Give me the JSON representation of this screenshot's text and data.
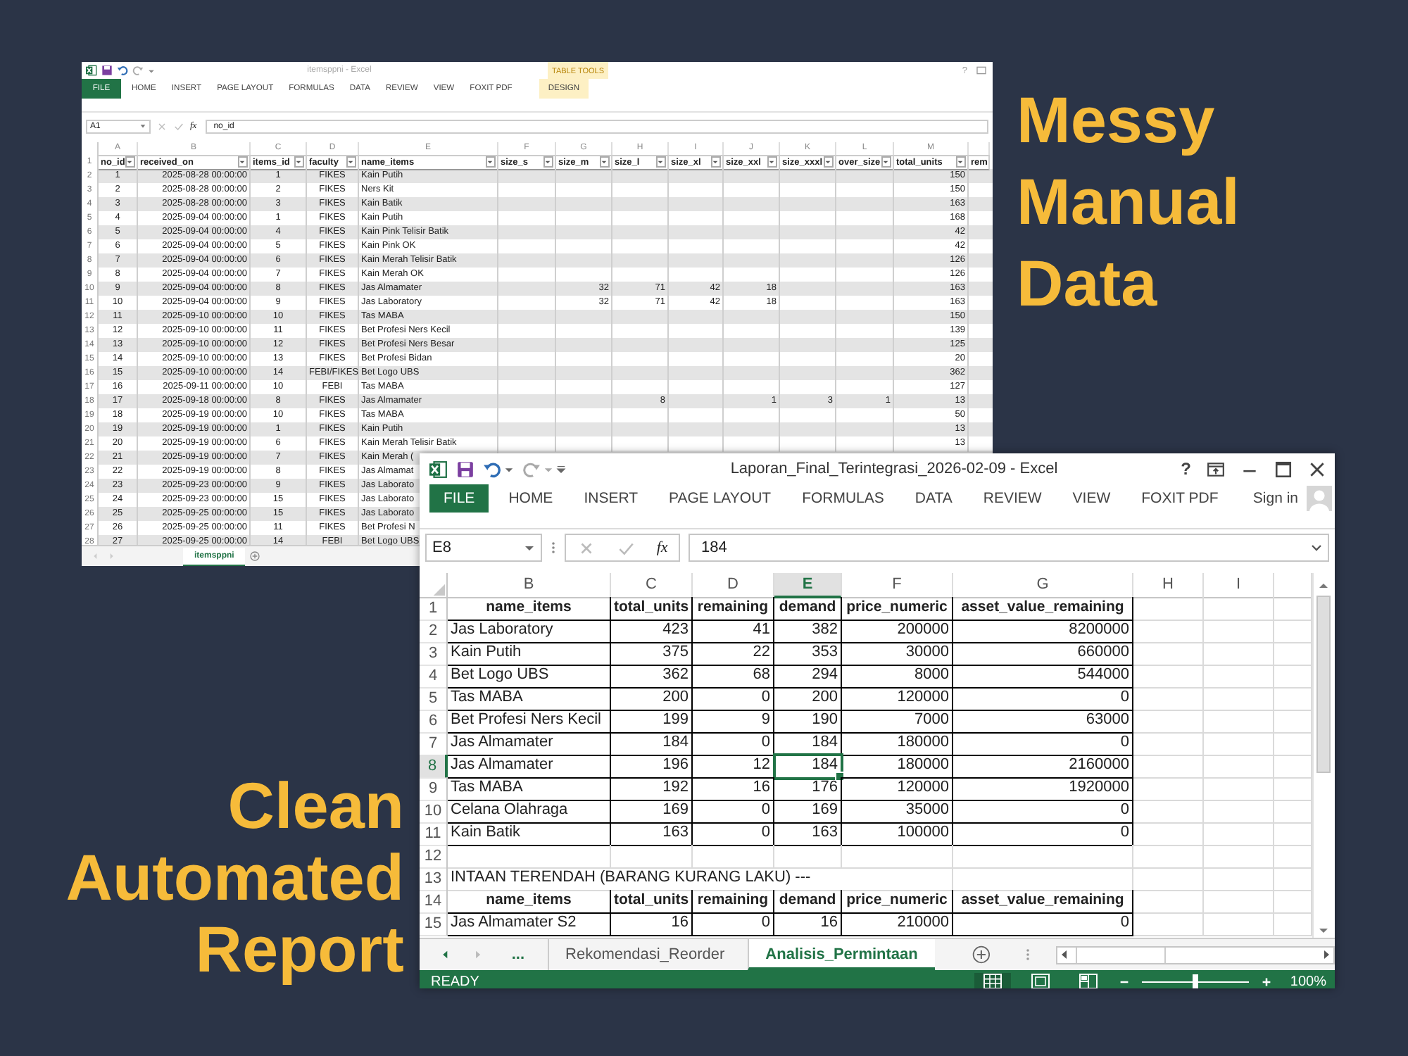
{
  "headline_top": [
    "Messy",
    "Manual",
    "Data"
  ],
  "headline_bottom": [
    "Clean",
    "Automated",
    "Report"
  ],
  "back_window": {
    "title": "itemsppni - Excel",
    "contextual_tab_group": "TABLE TOOLS",
    "help_label": "?",
    "ribbon_tabs": [
      {
        "label": "FILE",
        "kind": "file"
      },
      {
        "label": "HOME",
        "kind": "tab"
      },
      {
        "label": "INSERT",
        "kind": "tab"
      },
      {
        "label": "PAGE LAYOUT",
        "kind": "tab"
      },
      {
        "label": "FORMULAS",
        "kind": "tab"
      },
      {
        "label": "DATA",
        "kind": "tab"
      },
      {
        "label": "REVIEW",
        "kind": "tab"
      },
      {
        "label": "VIEW",
        "kind": "tab"
      },
      {
        "label": "FOXIT PDF",
        "kind": "tab"
      },
      {
        "label": "DESIGN",
        "kind": "contextual"
      }
    ],
    "name_box": "A1",
    "function_label": "fx",
    "formula": "no_id",
    "header_row_number": "1",
    "column_letters": [
      "A",
      "B",
      "C",
      "D",
      "E",
      "F",
      "G",
      "H",
      "I",
      "J",
      "K",
      "L",
      "M"
    ],
    "headers": [
      "no_id",
      "received_on",
      "items_id",
      "faculty",
      "name_items",
      "size_s",
      "size_m",
      "size_l",
      "size_xl",
      "size_xxl",
      "size_xxxl",
      "over_size",
      "total_units",
      "rem"
    ],
    "rows": [
      {
        "n": "2",
        "cells": [
          "1",
          "2025-08-28 00:00:00",
          "1",
          "FIKES",
          "Kain Putih",
          null,
          null,
          null,
          null,
          null,
          null,
          null,
          "150"
        ]
      },
      {
        "n": "3",
        "cells": [
          "2",
          "2025-08-28 00:00:00",
          "2",
          "FIKES",
          "Ners Kit",
          null,
          null,
          null,
          null,
          null,
          null,
          null,
          "150"
        ]
      },
      {
        "n": "4",
        "cells": [
          "3",
          "2025-08-28 00:00:00",
          "3",
          "FIKES",
          "Kain Batik",
          null,
          null,
          null,
          null,
          null,
          null,
          null,
          "163"
        ]
      },
      {
        "n": "5",
        "cells": [
          "4",
          "2025-09-04 00:00:00",
          "1",
          "FIKES",
          "Kain Putih",
          null,
          null,
          null,
          null,
          null,
          null,
          null,
          "168"
        ]
      },
      {
        "n": "6",
        "cells": [
          "5",
          "2025-09-04 00:00:00",
          "4",
          "FIKES",
          "Kain Pink Telisir Batik",
          null,
          null,
          null,
          null,
          null,
          null,
          null,
          "42"
        ]
      },
      {
        "n": "7",
        "cells": [
          "6",
          "2025-09-04 00:00:00",
          "5",
          "FIKES",
          "Kain Pink OK",
          null,
          null,
          null,
          null,
          null,
          null,
          null,
          "42"
        ]
      },
      {
        "n": "8",
        "cells": [
          "7",
          "2025-09-04 00:00:00",
          "6",
          "FIKES",
          "Kain Merah Telisir Batik",
          null,
          null,
          null,
          null,
          null,
          null,
          null,
          "126"
        ]
      },
      {
        "n": "9",
        "cells": [
          "8",
          "2025-09-04 00:00:00",
          "7",
          "FIKES",
          "Kain Merah OK",
          null,
          null,
          null,
          null,
          null,
          null,
          null,
          "126"
        ]
      },
      {
        "n": "10",
        "cells": [
          "9",
          "2025-09-04 00:00:00",
          "8",
          "FIKES",
          "Jas Almamater",
          null,
          "32",
          "71",
          "42",
          "18",
          null,
          null,
          "163"
        ]
      },
      {
        "n": "11",
        "cells": [
          "10",
          "2025-09-04 00:00:00",
          "9",
          "FIKES",
          "Jas Laboratory",
          null,
          "32",
          "71",
          "42",
          "18",
          null,
          null,
          "163"
        ]
      },
      {
        "n": "12",
        "cells": [
          "11",
          "2025-09-10 00:00:00",
          "10",
          "FIKES",
          "Tas MABA",
          null,
          null,
          null,
          null,
          null,
          null,
          null,
          "150"
        ]
      },
      {
        "n": "13",
        "cells": [
          "12",
          "2025-09-10 00:00:00",
          "11",
          "FIKES",
          "Bet Profesi Ners Kecil",
          null,
          null,
          null,
          null,
          null,
          null,
          null,
          "139"
        ]
      },
      {
        "n": "14",
        "cells": [
          "13",
          "2025-09-10 00:00:00",
          "12",
          "FIKES",
          "Bet Profesi Ners Besar",
          null,
          null,
          null,
          null,
          null,
          null,
          null,
          "125"
        ]
      },
      {
        "n": "15",
        "cells": [
          "14",
          "2025-09-10 00:00:00",
          "13",
          "FIKES",
          "Bet Profesi Bidan",
          null,
          null,
          null,
          null,
          null,
          null,
          null,
          "20"
        ]
      },
      {
        "n": "16",
        "cells": [
          "15",
          "2025-09-10 00:00:00",
          "14",
          "FEBI/FIKES",
          "Bet Logo UBS",
          null,
          null,
          null,
          null,
          null,
          null,
          null,
          "362"
        ]
      },
      {
        "n": "17",
        "cells": [
          "16",
          "2025-09-11 00:00:00",
          "10",
          "FEBI",
          "Tas MABA",
          null,
          null,
          null,
          null,
          null,
          null,
          null,
          "127"
        ]
      },
      {
        "n": "18",
        "cells": [
          "17",
          "2025-09-18 00:00:00",
          "8",
          "FIKES",
          "Jas Almamater",
          null,
          null,
          "8",
          null,
          "1",
          "3",
          "1",
          "13"
        ]
      },
      {
        "n": "19",
        "cells": [
          "18",
          "2025-09-19 00:00:00",
          "10",
          "FIKES",
          "Tas MABA",
          null,
          null,
          null,
          null,
          null,
          null,
          null,
          "50"
        ]
      },
      {
        "n": "20",
        "cells": [
          "19",
          "2025-09-19 00:00:00",
          "1",
          "FIKES",
          "Kain Putih",
          null,
          null,
          null,
          null,
          null,
          null,
          null,
          "13"
        ]
      },
      {
        "n": "21",
        "cells": [
          "20",
          "2025-09-19 00:00:00",
          "6",
          "FIKES",
          "Kain Merah Telisir Batik",
          null,
          null,
          null,
          null,
          null,
          null,
          null,
          "13"
        ]
      },
      {
        "n": "22",
        "cells": [
          "21",
          "2025-09-19 00:00:00",
          "7",
          "FIKES",
          "Kain Merah ("
        ]
      },
      {
        "n": "23",
        "cells": [
          "22",
          "2025-09-19 00:00:00",
          "8",
          "FIKES",
          "Jas Almamat"
        ]
      },
      {
        "n": "24",
        "cells": [
          "23",
          "2025-09-23 00:00:00",
          "9",
          "FIKES",
          "Jas Laborato"
        ]
      },
      {
        "n": "25",
        "cells": [
          "24",
          "2025-09-23 00:00:00",
          "15",
          "FIKES",
          "Jas Laborato"
        ]
      },
      {
        "n": "26",
        "cells": [
          "25",
          "2025-09-25 00:00:00",
          "15",
          "FIKES",
          "Jas Laborato"
        ]
      },
      {
        "n": "27",
        "cells": [
          "26",
          "2025-09-25 00:00:00",
          "11",
          "FIKES",
          "Bet Profesi N"
        ]
      },
      {
        "n": "28",
        "cells": [
          "27",
          "2025-09-25 00:00:00",
          "14",
          "FEBI",
          "Bet Logo UBS"
        ]
      }
    ],
    "sheet_tabs": [
      {
        "label": "itemsppni",
        "selected": true
      }
    ]
  },
  "front_window": {
    "title": "Laporan_Final_Terintegrasi_2026-02-09 - Excel",
    "help_label": "?",
    "ribbon_tabs": [
      {
        "label": "FILE",
        "kind": "file"
      },
      {
        "label": "HOME",
        "kind": "tab"
      },
      {
        "label": "INSERT",
        "kind": "tab"
      },
      {
        "label": "PAGE LAYOUT",
        "kind": "tab"
      },
      {
        "label": "FORMULAS",
        "kind": "tab"
      },
      {
        "label": "DATA",
        "kind": "tab"
      },
      {
        "label": "REVIEW",
        "kind": "tab"
      },
      {
        "label": "VIEW",
        "kind": "tab"
      },
      {
        "label": "FOXIT PDF",
        "kind": "tab"
      }
    ],
    "sign_in": "Sign in",
    "name_box": "E8",
    "function_label": "fx",
    "formula": "184",
    "column_letters": [
      {
        "label": "B",
        "selected": false
      },
      {
        "label": "C",
        "selected": false
      },
      {
        "label": "D",
        "selected": false
      },
      {
        "label": "E",
        "selected": true
      },
      {
        "label": "F",
        "selected": false
      },
      {
        "label": "G",
        "selected": false
      },
      {
        "label": "H",
        "selected": false
      },
      {
        "label": "I",
        "selected": false
      }
    ],
    "rows": [
      {
        "n": "1",
        "kind": "header",
        "selected": false,
        "cells": [
          "name_items",
          "total_units",
          "remaining",
          "demand",
          "price_numeric",
          "asset_value_remaining"
        ]
      },
      {
        "n": "2",
        "kind": "data",
        "selected": false,
        "cells": [
          "Jas Laboratory",
          "423",
          "41",
          "382",
          "200000",
          "8200000"
        ]
      },
      {
        "n": "3",
        "kind": "data",
        "selected": false,
        "cells": [
          "Kain Putih",
          "375",
          "22",
          "353",
          "30000",
          "660000"
        ]
      },
      {
        "n": "4",
        "kind": "data",
        "selected": false,
        "cells": [
          "Bet Logo UBS",
          "362",
          "68",
          "294",
          "8000",
          "544000"
        ]
      },
      {
        "n": "5",
        "kind": "data",
        "selected": false,
        "cells": [
          "Tas MABA",
          "200",
          "0",
          "200",
          "120000",
          "0"
        ]
      },
      {
        "n": "6",
        "kind": "data",
        "selected": false,
        "cells": [
          "Bet Profesi Ners Kecil",
          "199",
          "9",
          "190",
          "7000",
          "63000"
        ]
      },
      {
        "n": "7",
        "kind": "data",
        "selected": false,
        "cells": [
          "Jas Almamater",
          "184",
          "0",
          "184",
          "180000",
          "0"
        ]
      },
      {
        "n": "8",
        "kind": "data",
        "selected": true,
        "cells": [
          "Jas Almamater",
          "196",
          "12",
          "184",
          "180000",
          "2160000"
        ]
      },
      {
        "n": "9",
        "kind": "data",
        "selected": false,
        "cells": [
          "Tas MABA",
          "192",
          "16",
          "176",
          "120000",
          "1920000"
        ]
      },
      {
        "n": "10",
        "kind": "data",
        "selected": false,
        "cells": [
          "Celana Olahraga",
          "169",
          "0",
          "169",
          "35000",
          "0"
        ]
      },
      {
        "n": "11",
        "kind": "data",
        "selected": false,
        "cells": [
          "Kain Batik",
          "163",
          "0",
          "163",
          "100000",
          "0"
        ]
      },
      {
        "n": "12",
        "kind": "blank",
        "selected": false
      },
      {
        "n": "13",
        "kind": "note",
        "selected": false,
        "text": "INTAAN TERENDAH (BARANG KURANG LAKU) ---"
      },
      {
        "n": "14",
        "kind": "header",
        "selected": false,
        "cells": [
          "name_items",
          "total_units",
          "remaining",
          "demand",
          "price_numeric",
          "asset_value_remaining"
        ]
      },
      {
        "n": "15",
        "kind": "data",
        "selected": false,
        "cells": [
          "Jas Almamater S2",
          "16",
          "0",
          "16",
          "210000",
          "0"
        ]
      }
    ],
    "more_tabs": "...",
    "sheet_tabs": [
      {
        "label": "Rekomendasi_Reorder",
        "selected": false
      },
      {
        "label": "Analisis_Permintaan",
        "selected": true
      }
    ],
    "status": "READY",
    "zoom": {
      "level": 0.5,
      "reading": "100%"
    }
  }
}
